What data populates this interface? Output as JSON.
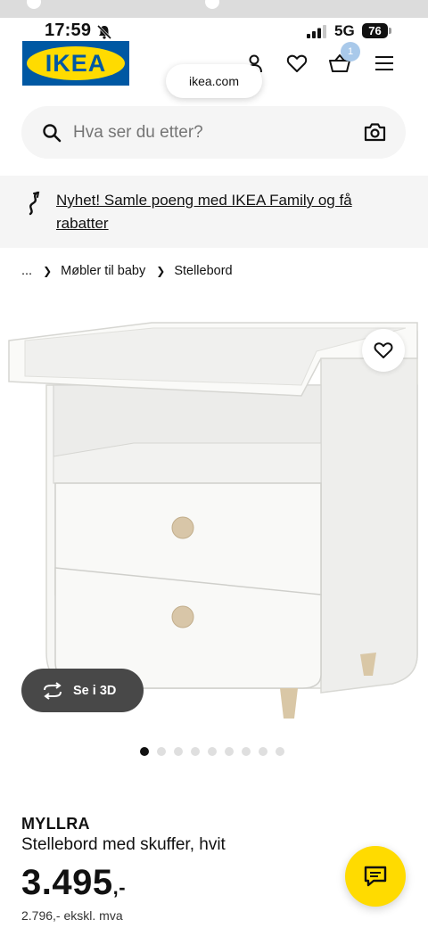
{
  "status_bar": {
    "time": "17:59",
    "network": "5G",
    "battery": "76"
  },
  "header": {
    "logo_text": "IKEA",
    "basket_count": "1"
  },
  "browser": {
    "url": "ikea.com"
  },
  "search": {
    "placeholder": "Hva ser du etter?"
  },
  "promo": {
    "text": "Nyhet! Samle poeng med IKEA Family og få rabatter"
  },
  "breadcrumb": {
    "ellipsis": "...",
    "items": [
      "Møbler til baby",
      "Stellebord"
    ]
  },
  "gallery": {
    "view_3d_label": "Se i 3D",
    "image_count": 9,
    "active_index": 0
  },
  "product": {
    "name": "MYLLRA",
    "description": "Stellebord med skuffer, hvit",
    "price": "3.495",
    "price_suffix": ",-",
    "price_ex_vat": "2.796,- ekskl. mva"
  },
  "colors": {
    "ikea_blue": "#0058a3",
    "ikea_yellow": "#ffdb00",
    "button_dark": "#484848",
    "surface_grey": "#f5f5f5"
  }
}
